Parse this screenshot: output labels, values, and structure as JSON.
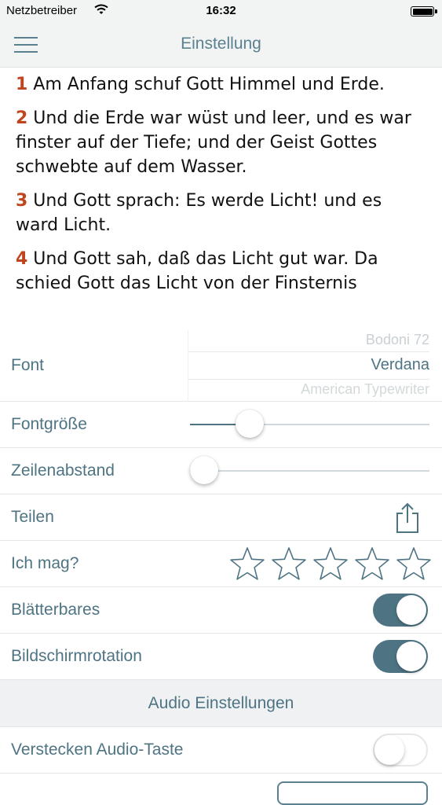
{
  "status_bar": {
    "carrier": "Netzbetreiber",
    "time": "16:32"
  },
  "nav": {
    "title": "Einstellung"
  },
  "verses": [
    {
      "num": "1",
      "text": " Am Anfang schuf Gott Himmel und Erde."
    },
    {
      "num": "2",
      "text": " Und die Erde war wüst und leer, und es war finster auf der Tiefe; und der Geist Gottes schwebte auf dem Wasser."
    },
    {
      "num": "3",
      "text": " Und Gott sprach: Es werde Licht! und es ward Licht."
    },
    {
      "num": "4",
      "text": " Und Gott sah, daß das Licht gut war. Da schied Gott das Licht von der Finsternis"
    }
  ],
  "settings": {
    "font": {
      "label": "Font",
      "options": [
        "Bodoni 72",
        "Verdana",
        "American Typewriter"
      ],
      "selected": "Verdana"
    },
    "font_size": {
      "label": "Fontgröße",
      "value_fraction": 0.25
    },
    "line_spacing": {
      "label": "Zeilenabstand",
      "value_fraction": 0.06
    },
    "share": {
      "label": "Teilen"
    },
    "rating": {
      "label": "Ich mag?",
      "stars_total": 5,
      "stars_filled": 0
    },
    "paging": {
      "label": "Blätterbares",
      "on": true
    },
    "rotation": {
      "label": "Bildschirmrotation",
      "on": true
    },
    "audio_header": "Audio Einstellungen",
    "hide_audio": {
      "label": "Verstecken Audio-Taste",
      "on": false
    }
  },
  "colors": {
    "accent": "#4e7484",
    "verse_number": "#c0451f",
    "bar_bg": "#f2f4f4"
  }
}
